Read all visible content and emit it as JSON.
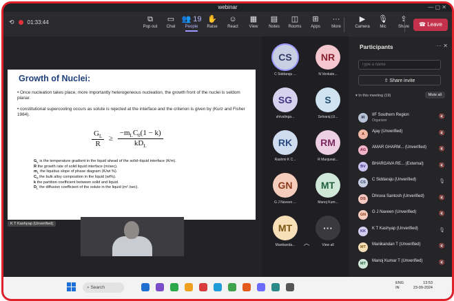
{
  "window": {
    "title": "webinar",
    "controls": "— ▢ ✕"
  },
  "recording": {
    "timer": "01:33:44"
  },
  "toolbar": {
    "items": [
      {
        "label": "Pop out",
        "icon": "popout-icon",
        "glyph": "⧉"
      },
      {
        "label": "Chat",
        "icon": "chat-icon",
        "glyph": "▭"
      },
      {
        "label": "People",
        "icon": "people-icon",
        "glyph": "👥",
        "count": "19"
      },
      {
        "label": "Raise",
        "icon": "raise-hand-icon",
        "glyph": "✋"
      },
      {
        "label": "React",
        "icon": "react-icon",
        "glyph": "☺"
      },
      {
        "label": "View",
        "icon": "view-icon",
        "glyph": "▦"
      },
      {
        "label": "Notes",
        "icon": "notes-icon",
        "glyph": "▤"
      },
      {
        "label": "Rooms",
        "icon": "rooms-icon",
        "glyph": "◫"
      },
      {
        "label": "Apps",
        "icon": "apps-icon",
        "glyph": "⊞"
      },
      {
        "label": "More",
        "icon": "more-icon",
        "glyph": "···"
      },
      {
        "label": "Camera",
        "icon": "camera-icon",
        "glyph": "▶"
      },
      {
        "label": "Mic",
        "icon": "mic-icon",
        "glyph": "🎙"
      },
      {
        "label": "Share",
        "icon": "share-icon",
        "glyph": "⇪"
      }
    ],
    "leave_label": "Leave"
  },
  "slide": {
    "title": "Growth of Nuclei:",
    "bullet1": "• Once nucleation takes place, more importantly heterogeneous nucleation, the growth front of the nuclei is seldom planar.",
    "bullet2": "• constitutional supercooling occurs as solute is rejected at the interface and the criterion is given by (Kurz and Fisher 1984).",
    "formula": {
      "lhs_num": "G",
      "lhs_num_sub": "L",
      "lhs_den": "R",
      "rel": "≥",
      "rhs_num": "−m",
      "rhs_num_sub": "L",
      "rhs_num_rest": "C",
      "rhs_num_sub2": "0",
      "rhs_num_tail": "(1 − k)",
      "rhs_den": "kD",
      "rhs_den_sub": "L"
    },
    "definitions": [
      {
        "sym": "G",
        "sub": "L",
        "text": " is the temperature gradient in the liquid ahead of the solid–liquid interface (K/m)."
      },
      {
        "sym": "R",
        "sub": "",
        "text": " the growth rate of solid liquid interface (m/sec)."
      },
      {
        "sym": "m",
        "sub": "L",
        "text": " the liquidus slope of phase diagram (K/wt %)."
      },
      {
        "sym": "C",
        "sub": "0",
        "text": " the bulk alloy composition in the liquid (wt%)."
      },
      {
        "sym": "k",
        "sub": "",
        "text": " the partition coefficient between solid and liquid."
      },
      {
        "sym": "D",
        "sub": "L",
        "text": " the diffusion coefficient of the solute in the liquid (m² /sec)."
      }
    ]
  },
  "presenter": {
    "tag": "K T Kashyap (Unverified)"
  },
  "gallery": {
    "tiles": [
      {
        "initials": "CS",
        "name": "C Siddaraju ...",
        "bg": "#c9cfe3",
        "fg": "#2b3760"
      },
      {
        "initials": "NR",
        "name": "N Venkate...",
        "bg": "#f3c7cd",
        "fg": "#8a2030"
      },
      {
        "initials": "SG",
        "name": "shivalinga...",
        "bg": "#d6d2ee",
        "fg": "#403580"
      },
      {
        "initials": "S",
        "name": "Selvaraj (U...",
        "bg": "#cfe3f0",
        "fg": "#1f4c6e"
      },
      {
        "initials": "RK",
        "name": "Rashmi K C...",
        "bg": "#cfdcf0",
        "fg": "#2a4a80"
      },
      {
        "initials": "RM",
        "name": "R Manjunat...",
        "bg": "#edcfe3",
        "fg": "#7a2a5f"
      },
      {
        "initials": "GN",
        "name": "G J Naveen ...",
        "bg": "#f5cdbd",
        "fg": "#8a3a1a"
      },
      {
        "initials": "MT",
        "name": "Manoj Kum...",
        "bg": "#cfe8d8",
        "fg": "#1f5e3a"
      },
      {
        "initials": "MT",
        "name": "Manikanda...",
        "bg": "#f7e0b8",
        "fg": "#7a5412"
      },
      {
        "initials": "···",
        "name": "View all",
        "bg": "#3a3a3e",
        "fg": "#dddddd"
      }
    ],
    "scroll_up": "︿"
  },
  "participants": {
    "title": "Participants",
    "header_icons": "··· ✕",
    "search_placeholder": "Type a name",
    "share_invite": "Share invite",
    "in_meeting": "▾ In this meeting (19)",
    "mute_all": "Mute all",
    "list": [
      {
        "initials": "IR",
        "name": "IIF Southern Region",
        "sub": "Organizer",
        "bg": "#b8c4d6",
        "fg": "#24324a",
        "mic": "🔇"
      },
      {
        "initials": "A",
        "name": "Ajay (Unverified)",
        "sub": "",
        "bg": "#f2b8a6",
        "fg": "#7a2a12",
        "mic": "🔇"
      },
      {
        "initials": "AG",
        "name": "AMAR GHARM... (Unverified)",
        "sub": "",
        "bg": "#f0b6c8",
        "fg": "#7a1e3d",
        "mic": "🔇"
      },
      {
        "initials": "BV",
        "name": "BHARGAVA RE... (External)",
        "sub": "",
        "bg": "#c9c3ee",
        "fg": "#3a2f80",
        "mic": "🔇"
      },
      {
        "initials": "CS",
        "name": "C Siddaraju (Unverified)",
        "sub": "",
        "bg": "#c9cfe3",
        "fg": "#2b3760",
        "mic": "🎙"
      },
      {
        "initials": "DS",
        "name": "Dhruva Santosh (Unverified)",
        "sub": "",
        "bg": "#f5c9c0",
        "fg": "#7a2a1a",
        "mic": "🔇"
      },
      {
        "initials": "GN",
        "name": "G J Naveen (Unverified)",
        "sub": "",
        "bg": "#f5cdbd",
        "fg": "#8a3a1a",
        "mic": "🔇"
      },
      {
        "initials": "KK",
        "name": "K T Kashyap (Unverified)",
        "sub": "",
        "bg": "#d4cff2",
        "fg": "#3a3080",
        "mic": "🎙"
      },
      {
        "initials": "MT",
        "name": "Manikandan T (Unverified)",
        "sub": "",
        "bg": "#f7e0b8",
        "fg": "#7a5412",
        "mic": "🔇"
      },
      {
        "initials": "MT",
        "name": "Manoj Kumar T (Unverified)",
        "sub": "",
        "bg": "#cfe8d8",
        "fg": "#1f5e3a",
        "mic": "🔇"
      }
    ]
  },
  "taskbar": {
    "search": "Search",
    "lang_top": "ENG",
    "lang_bottom": "IN",
    "time": "13:53",
    "date": "23-09-2024",
    "app_colors": [
      "#1f6fd0",
      "#7a4ec9",
      "#2aa84a",
      "#f0a020",
      "#d83b3b",
      "#1f9bd7",
      "#3fa34d",
      "#e25a1c",
      "#6c6cff",
      "#2a8a8a",
      "#555555"
    ]
  },
  "colors": {
    "accent": "#9c99ff",
    "leave": "#c4314b",
    "border": "#e0202a"
  }
}
